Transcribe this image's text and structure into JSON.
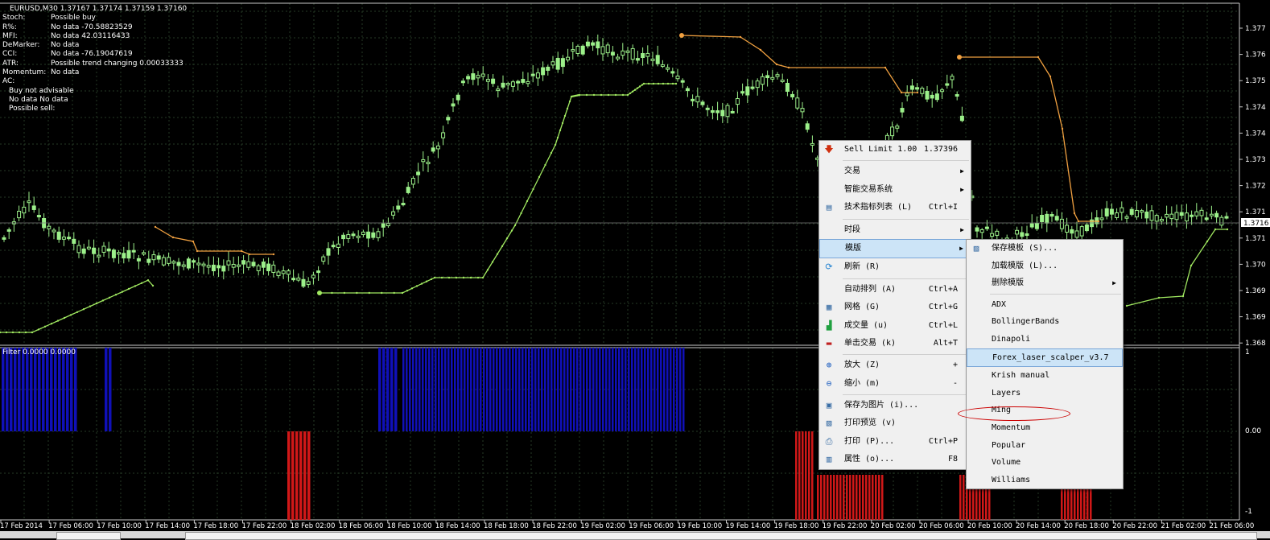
{
  "chart": {
    "header": "EURUSD,M30  1.37167 1.37174 1.37159 1.37160",
    "indicators": [
      {
        "label": "Stoch:",
        "value": "Possible buy"
      },
      {
        "label": "R%:",
        "value": "No data -70.58823529"
      },
      {
        "label": "MFI:",
        "value": "No data 42.03116433"
      },
      {
        "label": "DeMarker:",
        "value": "No data"
      },
      {
        "label": "CCI:",
        "value": "No data -76.19047619"
      },
      {
        "label": "ATR:",
        "value": "Possible trend changing 0.00033333"
      },
      {
        "label": "Momentum:",
        "value": "No data"
      },
      {
        "label": "AC:",
        "value": ""
      },
      {
        "label": "",
        "value": "Buy not advisable"
      },
      {
        "label": "",
        "value": "No data No data"
      },
      {
        "label": "",
        "value": "Possible sell:"
      }
    ],
    "filter_label": "Filter 0.0000 0.0000",
    "price_axis": [
      "1.377",
      "1.376",
      "1.375",
      "1.374",
      "1.374",
      "1.373",
      "1.372",
      "1.371",
      "1.371",
      "1.370",
      "1.369",
      "1.369",
      "1.368"
    ],
    "current_price": "1.3716",
    "filter_axis": [
      "1",
      "0.00",
      "-1"
    ],
    "time_axis": [
      "17 Feb 2014",
      "17 Feb 06:00",
      "17 Feb 10:00",
      "17 Feb 14:00",
      "17 Feb 18:00",
      "17 Feb 22:00",
      "18 Feb 02:00",
      "18 Feb 06:00",
      "18 Feb 10:00",
      "18 Feb 14:00",
      "18 Feb 18:00",
      "18 Feb 22:00",
      "19 Feb 02:00",
      "19 Feb 06:00",
      "19 Feb 10:00",
      "19 Feb 14:00",
      "19 Feb 18:00",
      "19 Feb 22:00",
      "20 Feb 02:00",
      "20 Feb 06:00",
      "20 Feb 10:00",
      "20 Feb 14:00",
      "20 Feb 18:00",
      "20 Feb 22:00",
      "21 Feb 02:00",
      "21 Feb 06:00"
    ],
    "colors": {
      "background": "#000000",
      "grid": "#2a3f2a",
      "candle": "#9cf08a",
      "trail_green": "#a0e860",
      "trail_orange": "#f0a040",
      "filter_blue": "#1010b8",
      "filter_red": "#d01818"
    }
  },
  "context_menu": {
    "items": [
      {
        "label": "Sell Limit 1.00",
        "shortcut": "1.37396",
        "icon": "arrow-down-icon"
      },
      {
        "label": "交易",
        "arrow": "▶"
      },
      {
        "label": "智能交易系统",
        "arrow": "▶"
      },
      {
        "label": "技术指标列表 (L)",
        "shortcut": "Ctrl+I",
        "icon": "indicator-list-icon"
      },
      {
        "label": "时段",
        "arrow": "▶"
      },
      {
        "label": "模版",
        "arrow": "▶"
      },
      {
        "label": "刷新 (R)",
        "icon": "refresh-icon"
      },
      {
        "label": "自动排列 (A)",
        "shortcut": "Ctrl+A"
      },
      {
        "label": "网格 (G)",
        "shortcut": "Ctrl+G",
        "icon": "grid-icon"
      },
      {
        "label": "成交量 (u)",
        "shortcut": "Ctrl+L",
        "icon": "volume-icon"
      },
      {
        "label": "单击交易 (k)",
        "shortcut": "Alt+T",
        "icon": "one-click-icon"
      },
      {
        "label": "放大 (Z)",
        "shortcut": "+",
        "icon": "zoom-in-icon"
      },
      {
        "label": "缩小 (m)",
        "shortcut": "-",
        "icon": "zoom-out-icon"
      },
      {
        "label": "保存为图片 (i)...",
        "icon": "save-picture-icon"
      },
      {
        "label": "打印预览 (v)",
        "icon": "print-preview-icon"
      },
      {
        "label": "打印 (P)...",
        "shortcut": "Ctrl+P",
        "icon": "print-icon"
      },
      {
        "label": "属性 (o)...",
        "shortcut": "F8",
        "icon": "properties-icon"
      }
    ]
  },
  "template_submenu": {
    "items": [
      {
        "label": "保存模板 (S)...",
        "icon": "save-template-icon"
      },
      {
        "label": "加载模版 (L)..."
      },
      {
        "label": "删除模版",
        "arrow": "▶"
      },
      {
        "label": "ADX"
      },
      {
        "label": "BollingerBands"
      },
      {
        "label": "Dinapoli"
      },
      {
        "label": "Forex_laser_scalper_v3.7"
      },
      {
        "label": "Krish manual"
      },
      {
        "label": "Layers"
      },
      {
        "label": "Ming"
      },
      {
        "label": "Momentum"
      },
      {
        "label": "Popular"
      },
      {
        "label": "Volume"
      },
      {
        "label": "Williams"
      }
    ]
  }
}
